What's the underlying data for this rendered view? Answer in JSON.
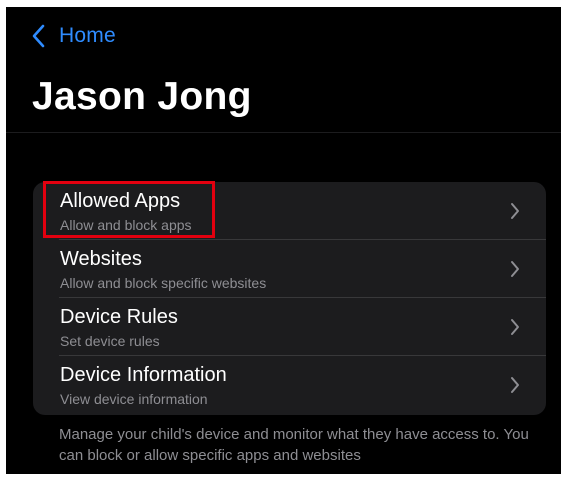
{
  "nav": {
    "back_label": "Home",
    "back_icon": "chevron-left-icon"
  },
  "page": {
    "title": "Jason Jong"
  },
  "settings": {
    "items": [
      {
        "title": "Allowed Apps",
        "subtitle": "Allow and block apps",
        "icon": "chevron-right-icon"
      },
      {
        "title": "Websites",
        "subtitle": "Allow and block specific websites",
        "icon": "chevron-right-icon"
      },
      {
        "title": "Device Rules",
        "subtitle": "Set device rules",
        "icon": "chevron-right-icon"
      },
      {
        "title": "Device Information",
        "subtitle": "View device information",
        "icon": "chevron-right-icon"
      }
    ]
  },
  "footer": {
    "text": "Manage your child's device and monitor what they have access to. You can block or allow specific apps and websites"
  },
  "colors": {
    "background": "#000000",
    "group_background": "#1c1c1e",
    "accent": "#2f8cff",
    "highlight_box": "#e3000f",
    "secondary_text": "#8e8e93"
  }
}
